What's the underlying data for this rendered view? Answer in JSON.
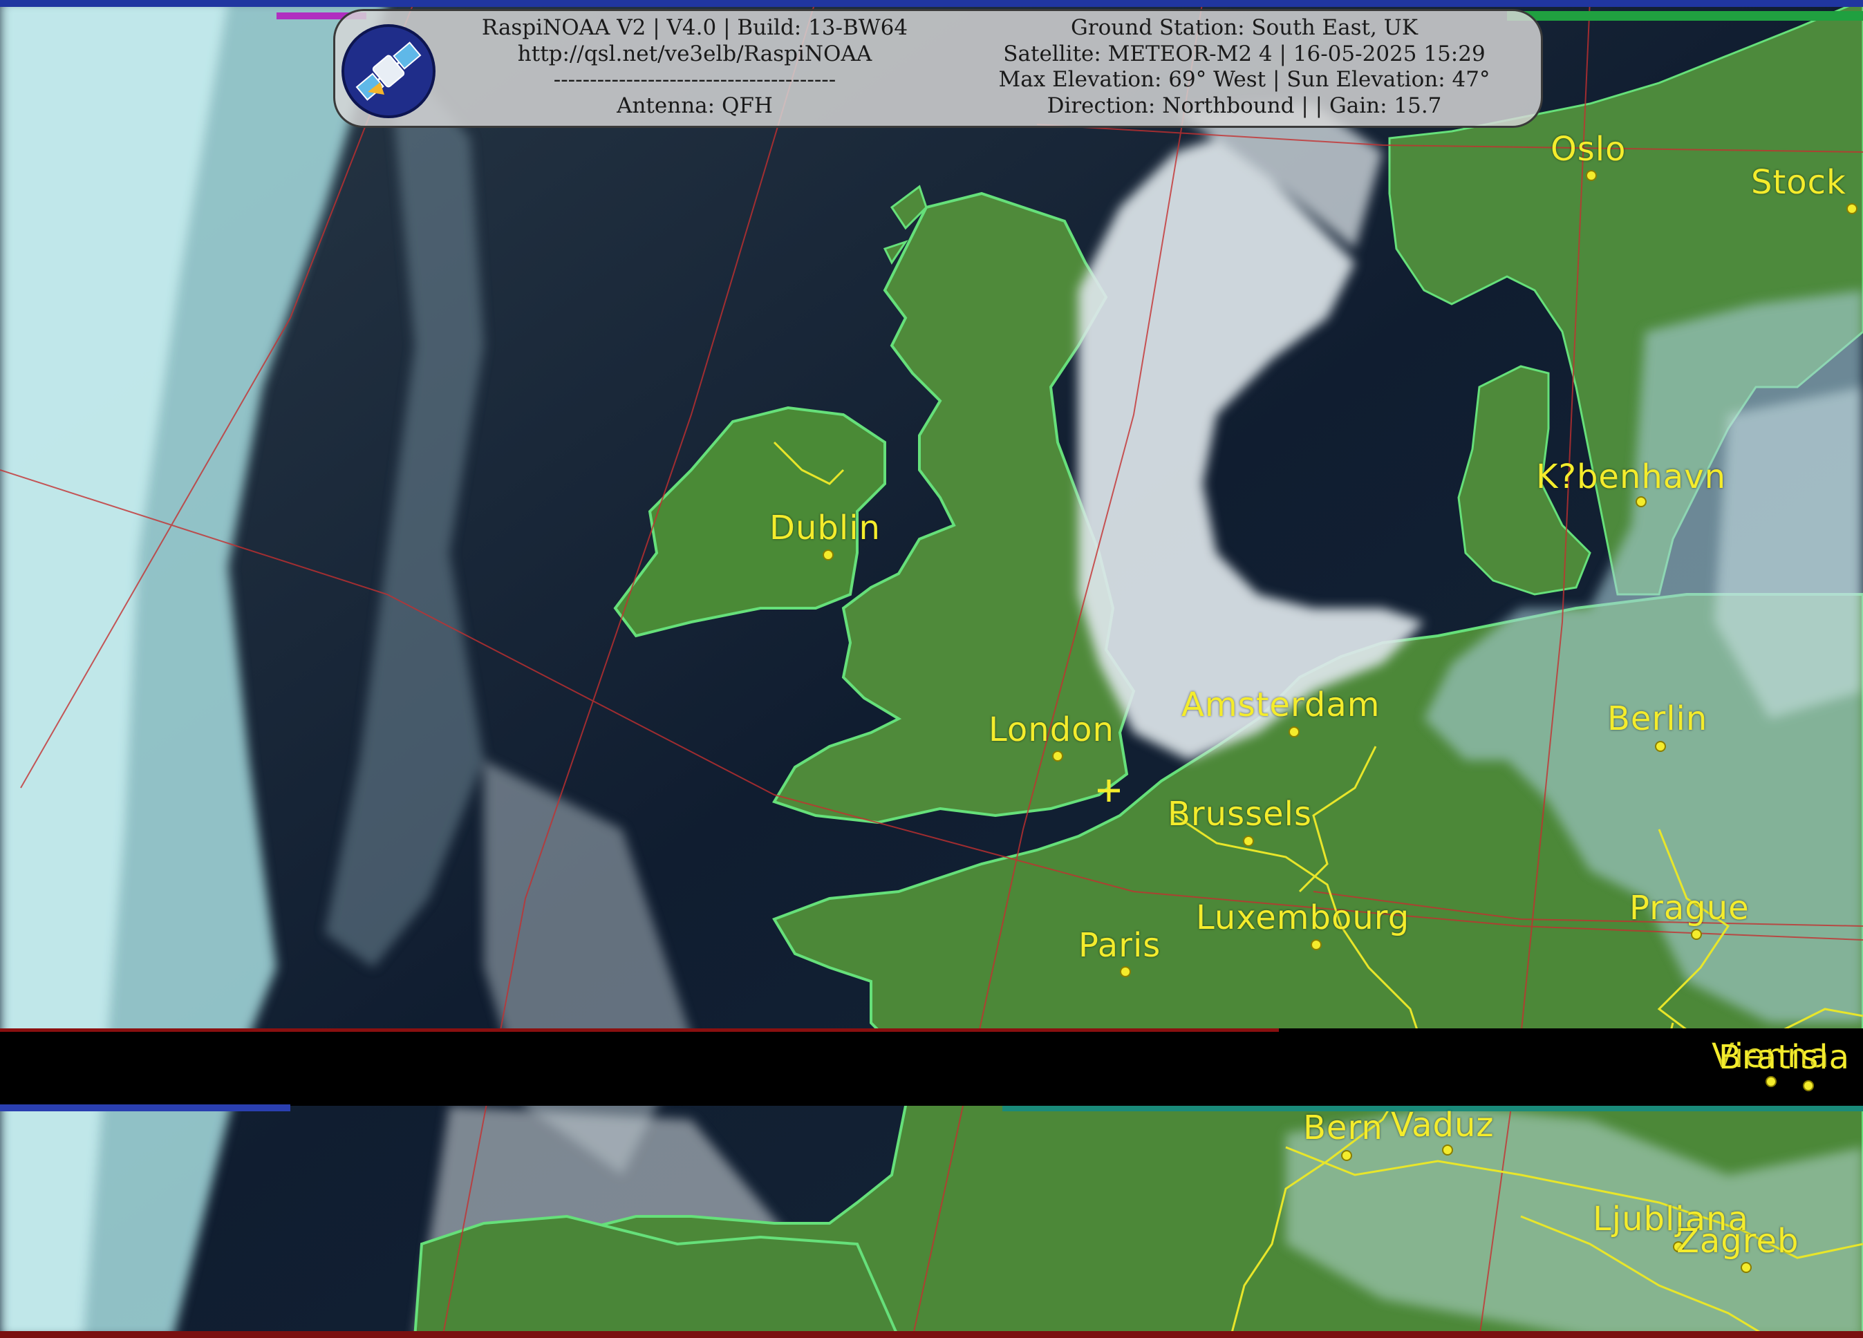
{
  "header": {
    "left_lines": [
      "RaspiNOAA V2 | V4.0 | Build: 13-BW64",
      "http://qsl.net/ve3elb/RaspiNOAA",
      "---------------------------------------",
      "Antenna: QFH"
    ],
    "right_lines": [
      "Ground Station: South East, UK",
      "Satellite: METEOR-M2 4 | 16-05-2025 15:29",
      "Max Elevation: 69° West | Sun Elevation: 47°",
      "Direction: Northbound | | Gain: 15.7"
    ]
  },
  "logo": {
    "icon": "satellite-icon"
  },
  "cities": [
    {
      "name": "Oslo"
    },
    {
      "name": "Stock"
    },
    {
      "name": "K?benhavn"
    },
    {
      "name": "Dublin"
    },
    {
      "name": "Amsterdam"
    },
    {
      "name": "London"
    },
    {
      "name": "Berlin"
    },
    {
      "name": "Brussels"
    },
    {
      "name": "Luxembourg"
    },
    {
      "name": "Paris"
    },
    {
      "name": "Prague"
    },
    {
      "name": "Vienna"
    },
    {
      "name": "Bratisla"
    },
    {
      "name": "Bern"
    },
    {
      "name": "Vaduz"
    },
    {
      "name": "Ljubljana"
    },
    {
      "name": "Zagreb"
    }
  ],
  "colors": {
    "land": "#4f8a3a",
    "sea": "#0e1a2c",
    "cloud": "#d9e6ea",
    "coastline": "#66e07a",
    "border": "#e8e62a",
    "label": "#f4ec2c",
    "grid": "#c43030"
  }
}
